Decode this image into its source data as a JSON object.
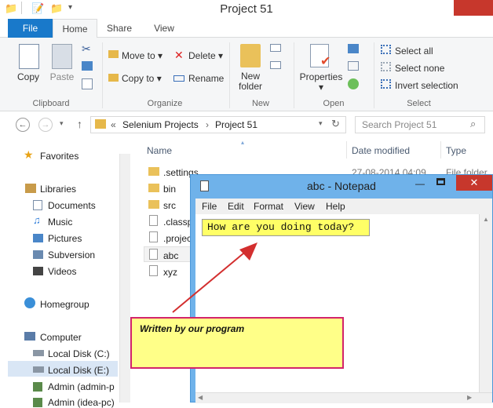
{
  "window": {
    "title": "Project 51"
  },
  "ribbon": {
    "tabs": [
      "File",
      "Home",
      "Share",
      "View"
    ],
    "clipboard": {
      "copy": "Copy",
      "paste": "Paste",
      "label": "Clipboard"
    },
    "organize": {
      "move_to": "Move to",
      "copy_to": "Copy to",
      "delete": "Delete",
      "rename": "Rename",
      "label": "Organize"
    },
    "new": {
      "new_folder_line1": "New",
      "new_folder_line2": "folder",
      "label": "New"
    },
    "open": {
      "properties": "Properties",
      "label": "Open"
    },
    "select": {
      "select_all": "Select all",
      "select_none": "Select none",
      "invert": "Invert selection",
      "label": "Select"
    }
  },
  "address": {
    "chevron": "«",
    "crumbs": [
      "Selenium Projects",
      "Project 51"
    ],
    "search_placeholder": "Search Project 51"
  },
  "nav_pane": {
    "favorites": "Favorites",
    "libraries": "Libraries",
    "library_items": [
      "Documents",
      "Music",
      "Pictures",
      "Subversion",
      "Videos"
    ],
    "homegroup": "Homegroup",
    "computer": "Computer",
    "drives": [
      "Local Disk (C:)",
      "Local Disk (E:)",
      "Admin (admin-p",
      "Admin (idea-pc)"
    ]
  },
  "file_list": {
    "columns": {
      "name": "Name",
      "date": "Date modified",
      "type": "Type"
    },
    "rows": [
      {
        "name": ".settings",
        "date": "27-08-2014 04:09 ...",
        "type": "File folder"
      },
      {
        "name": "bin",
        "date": "",
        "type": ""
      },
      {
        "name": "src",
        "date": "",
        "type": ""
      },
      {
        "name": ".classp",
        "date": "",
        "type": ""
      },
      {
        "name": ".projec",
        "date": "",
        "type": ""
      },
      {
        "name": "abc",
        "date": "",
        "type": ""
      },
      {
        "name": "xyz",
        "date": "",
        "type": ""
      }
    ]
  },
  "notepad": {
    "title": "abc - Notepad",
    "menu": [
      "File",
      "Edit",
      "Format",
      "View",
      "Help"
    ],
    "content": "How are you doing today?"
  },
  "annotation": {
    "text": "Written by our program"
  },
  "colors": {
    "accent": "#1979ca",
    "notepad_frame": "#6fb2ea",
    "close": "#c7372c",
    "arrow": "#d32f2f",
    "note_border": "#d3246b"
  }
}
